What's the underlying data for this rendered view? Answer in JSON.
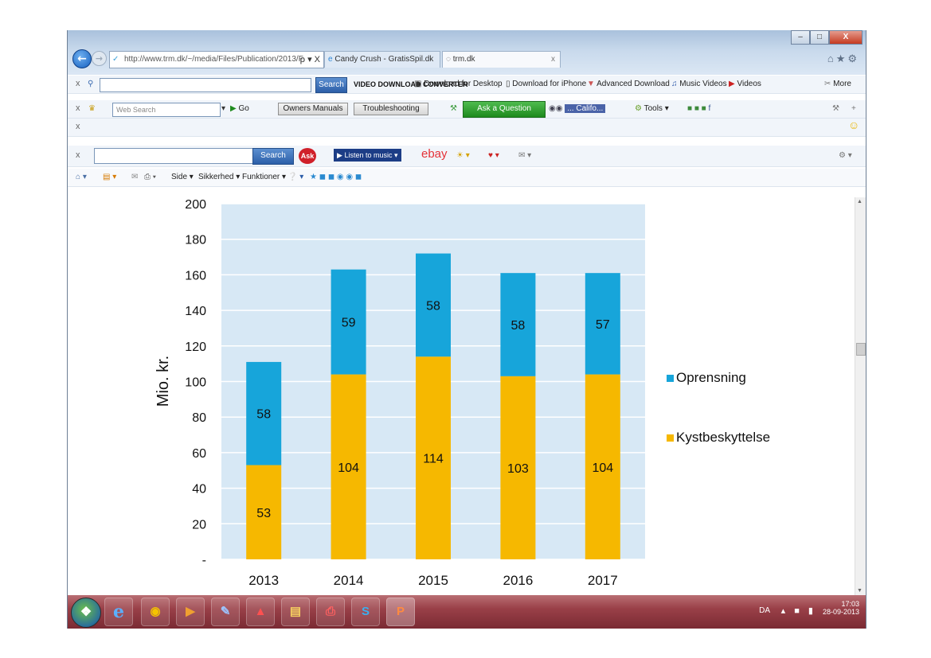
{
  "browser": {
    "address": "http://www.trm.dk/~/media/Files/Publication/2013/F",
    "address_controls": "ρ ▾ X",
    "tabs": [
      {
        "label": "Candy Crush - GratisSpil.dk"
      },
      {
        "label": "trm.dk",
        "close": "x"
      }
    ],
    "window_controls": [
      "–",
      "□",
      "X"
    ]
  },
  "toolbar1": {
    "close": "x",
    "search_button": "Search",
    "video_converter": "VIDEO DOWNLOAD CONVERTER",
    "download_desktop": "Download for Desktop",
    "download_iphone": "Download for iPhone",
    "advanced_download": "Advanced Download",
    "music_videos": "Music Videos",
    "videos": "Videos",
    "more": "More"
  },
  "toolbar2": {
    "close": "x",
    "web_search_placeholder": "Web Search",
    "go": "Go",
    "owners_manuals": "Owners Manuals",
    "troubleshooting": "Troubleshooting",
    "ask_question": "Ask a Question",
    "location": "... Califo...",
    "tools": "Tools"
  },
  "toolbar3": {
    "close": "x"
  },
  "toolbar4": {
    "close": "x",
    "search_button": "Search",
    "ask_logo": "Ask",
    "listen": "Listen to music",
    "ebay": "ebay"
  },
  "commandbar": {
    "side": "Side",
    "sikkerhed": "Sikkerhed",
    "funktioner": "Funktioner"
  },
  "taskbar": {
    "lang": "DA",
    "time": "17:03",
    "date": "28-09-2013"
  },
  "chart_data": {
    "type": "bar",
    "stacked": true,
    "categories": [
      "2013",
      "2014",
      "2015",
      "2016",
      "2017"
    ],
    "series": [
      {
        "name": "Kystbeskyttelse",
        "values": [
          53,
          104,
          114,
          103,
          104
        ],
        "color": "#f6b800"
      },
      {
        "name": "Oprensning",
        "values": [
          58,
          59,
          58,
          58,
          57
        ],
        "color": "#17a5da"
      }
    ],
    "ylabel": "Mio. kr.",
    "ylim": [
      0,
      200
    ],
    "yticks": [
      "-",
      "20",
      "40",
      "60",
      "80",
      "100",
      "120",
      "140",
      "160",
      "180",
      "200"
    ],
    "plot_background": "#d7e8f5",
    "grid": true,
    "legend_position": "right"
  }
}
